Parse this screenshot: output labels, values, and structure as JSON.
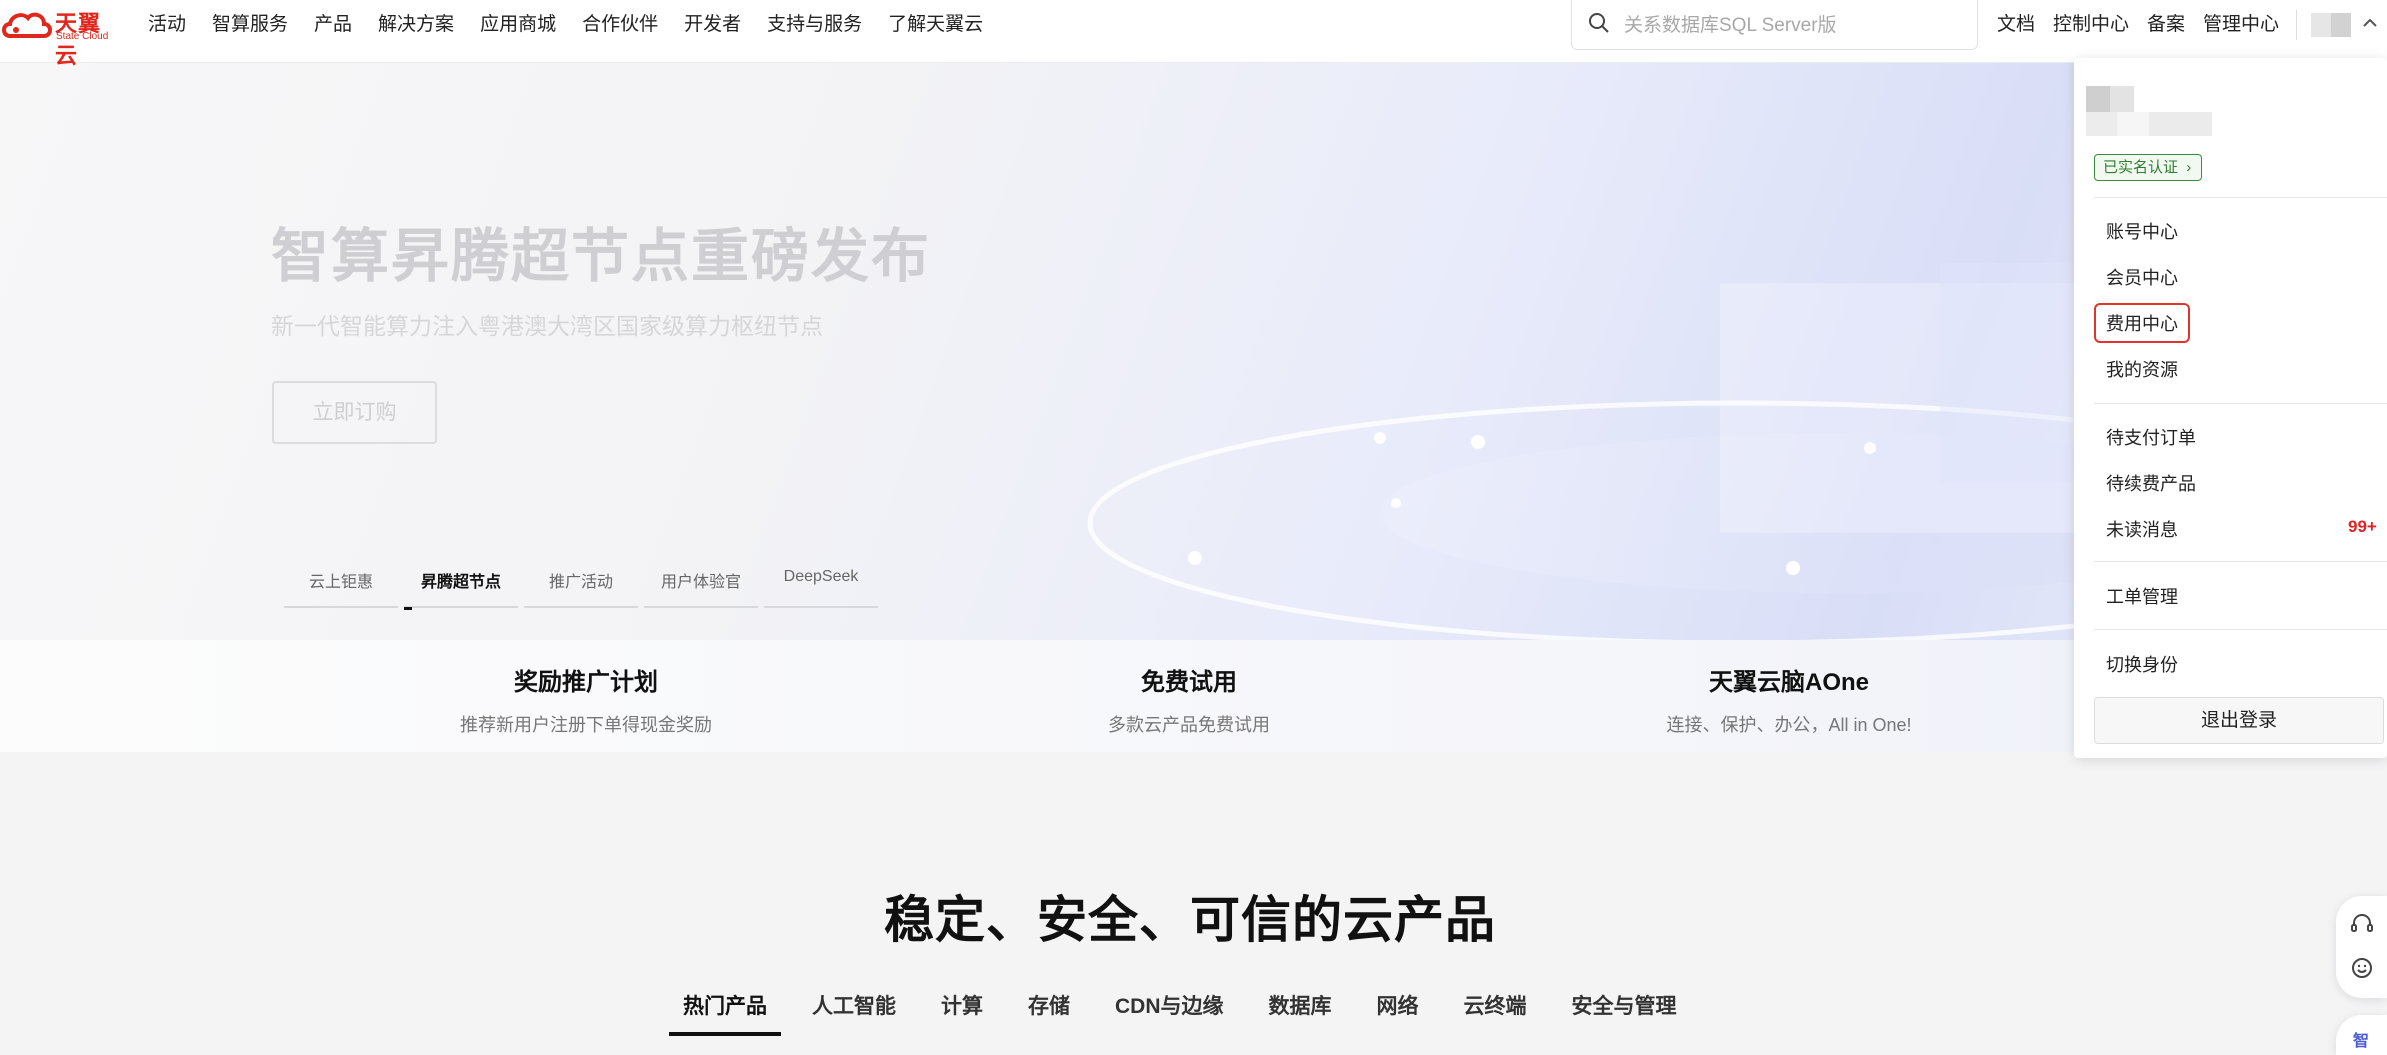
{
  "header": {
    "brand": "天翼云",
    "brand_sub": "State Cloud",
    "nav": [
      "活动",
      "智算服务",
      "产品",
      "解决方案",
      "应用商城",
      "合作伙伴",
      "开发者",
      "支持与服务",
      "了解天翼云"
    ],
    "search_placeholder": "关系数据库SQL Server版",
    "right_links": [
      "文档",
      "控制中心",
      "备案",
      "管理中心"
    ]
  },
  "hero": {
    "title": "智算昇腾超节点重磅发布",
    "subtitle": "新一代智能算力注入粤港澳大湾区国家级算力枢纽节点",
    "cta": "立即订购",
    "tabs": [
      "云上钜惠",
      "昇腾超节点",
      "推广活动",
      "用户体验官",
      "DeepSeek"
    ],
    "active_tab": "昇腾超节点"
  },
  "promos": [
    {
      "title": "奖励推广计划",
      "desc": "推荐新用户注册下单得现金奖励"
    },
    {
      "title": "免费试用",
      "desc": "多款云产品免费试用"
    },
    {
      "title": "天翼云脑AOne",
      "desc": "连接、保护、办公，All in One!"
    }
  ],
  "section": {
    "title": "稳定、安全、可信的云产品",
    "tabs": [
      "热门产品",
      "人工智能",
      "计算",
      "存储",
      "CDN与边缘",
      "数据库",
      "网络",
      "云终端",
      "安全与管理"
    ],
    "active_tab": "热门产品"
  },
  "user_menu": {
    "verified_badge": "已实名认证",
    "group1": [
      "账号中心",
      "会员中心",
      "费用中心",
      "我的资源"
    ],
    "highlighted": "费用中心",
    "group2": [
      "待支付订单",
      "待续费产品",
      "未读消息"
    ],
    "unread_count": "99+",
    "group3": [
      "工单管理"
    ],
    "group4": [
      "切换身份"
    ],
    "logout": "退出登录"
  },
  "float": {
    "bottom_label": "智"
  },
  "colors": {
    "brand": "#e1261c",
    "verified": "#2f7d2f",
    "highlight_border": "#e2342c",
    "unread": "#e02424"
  }
}
